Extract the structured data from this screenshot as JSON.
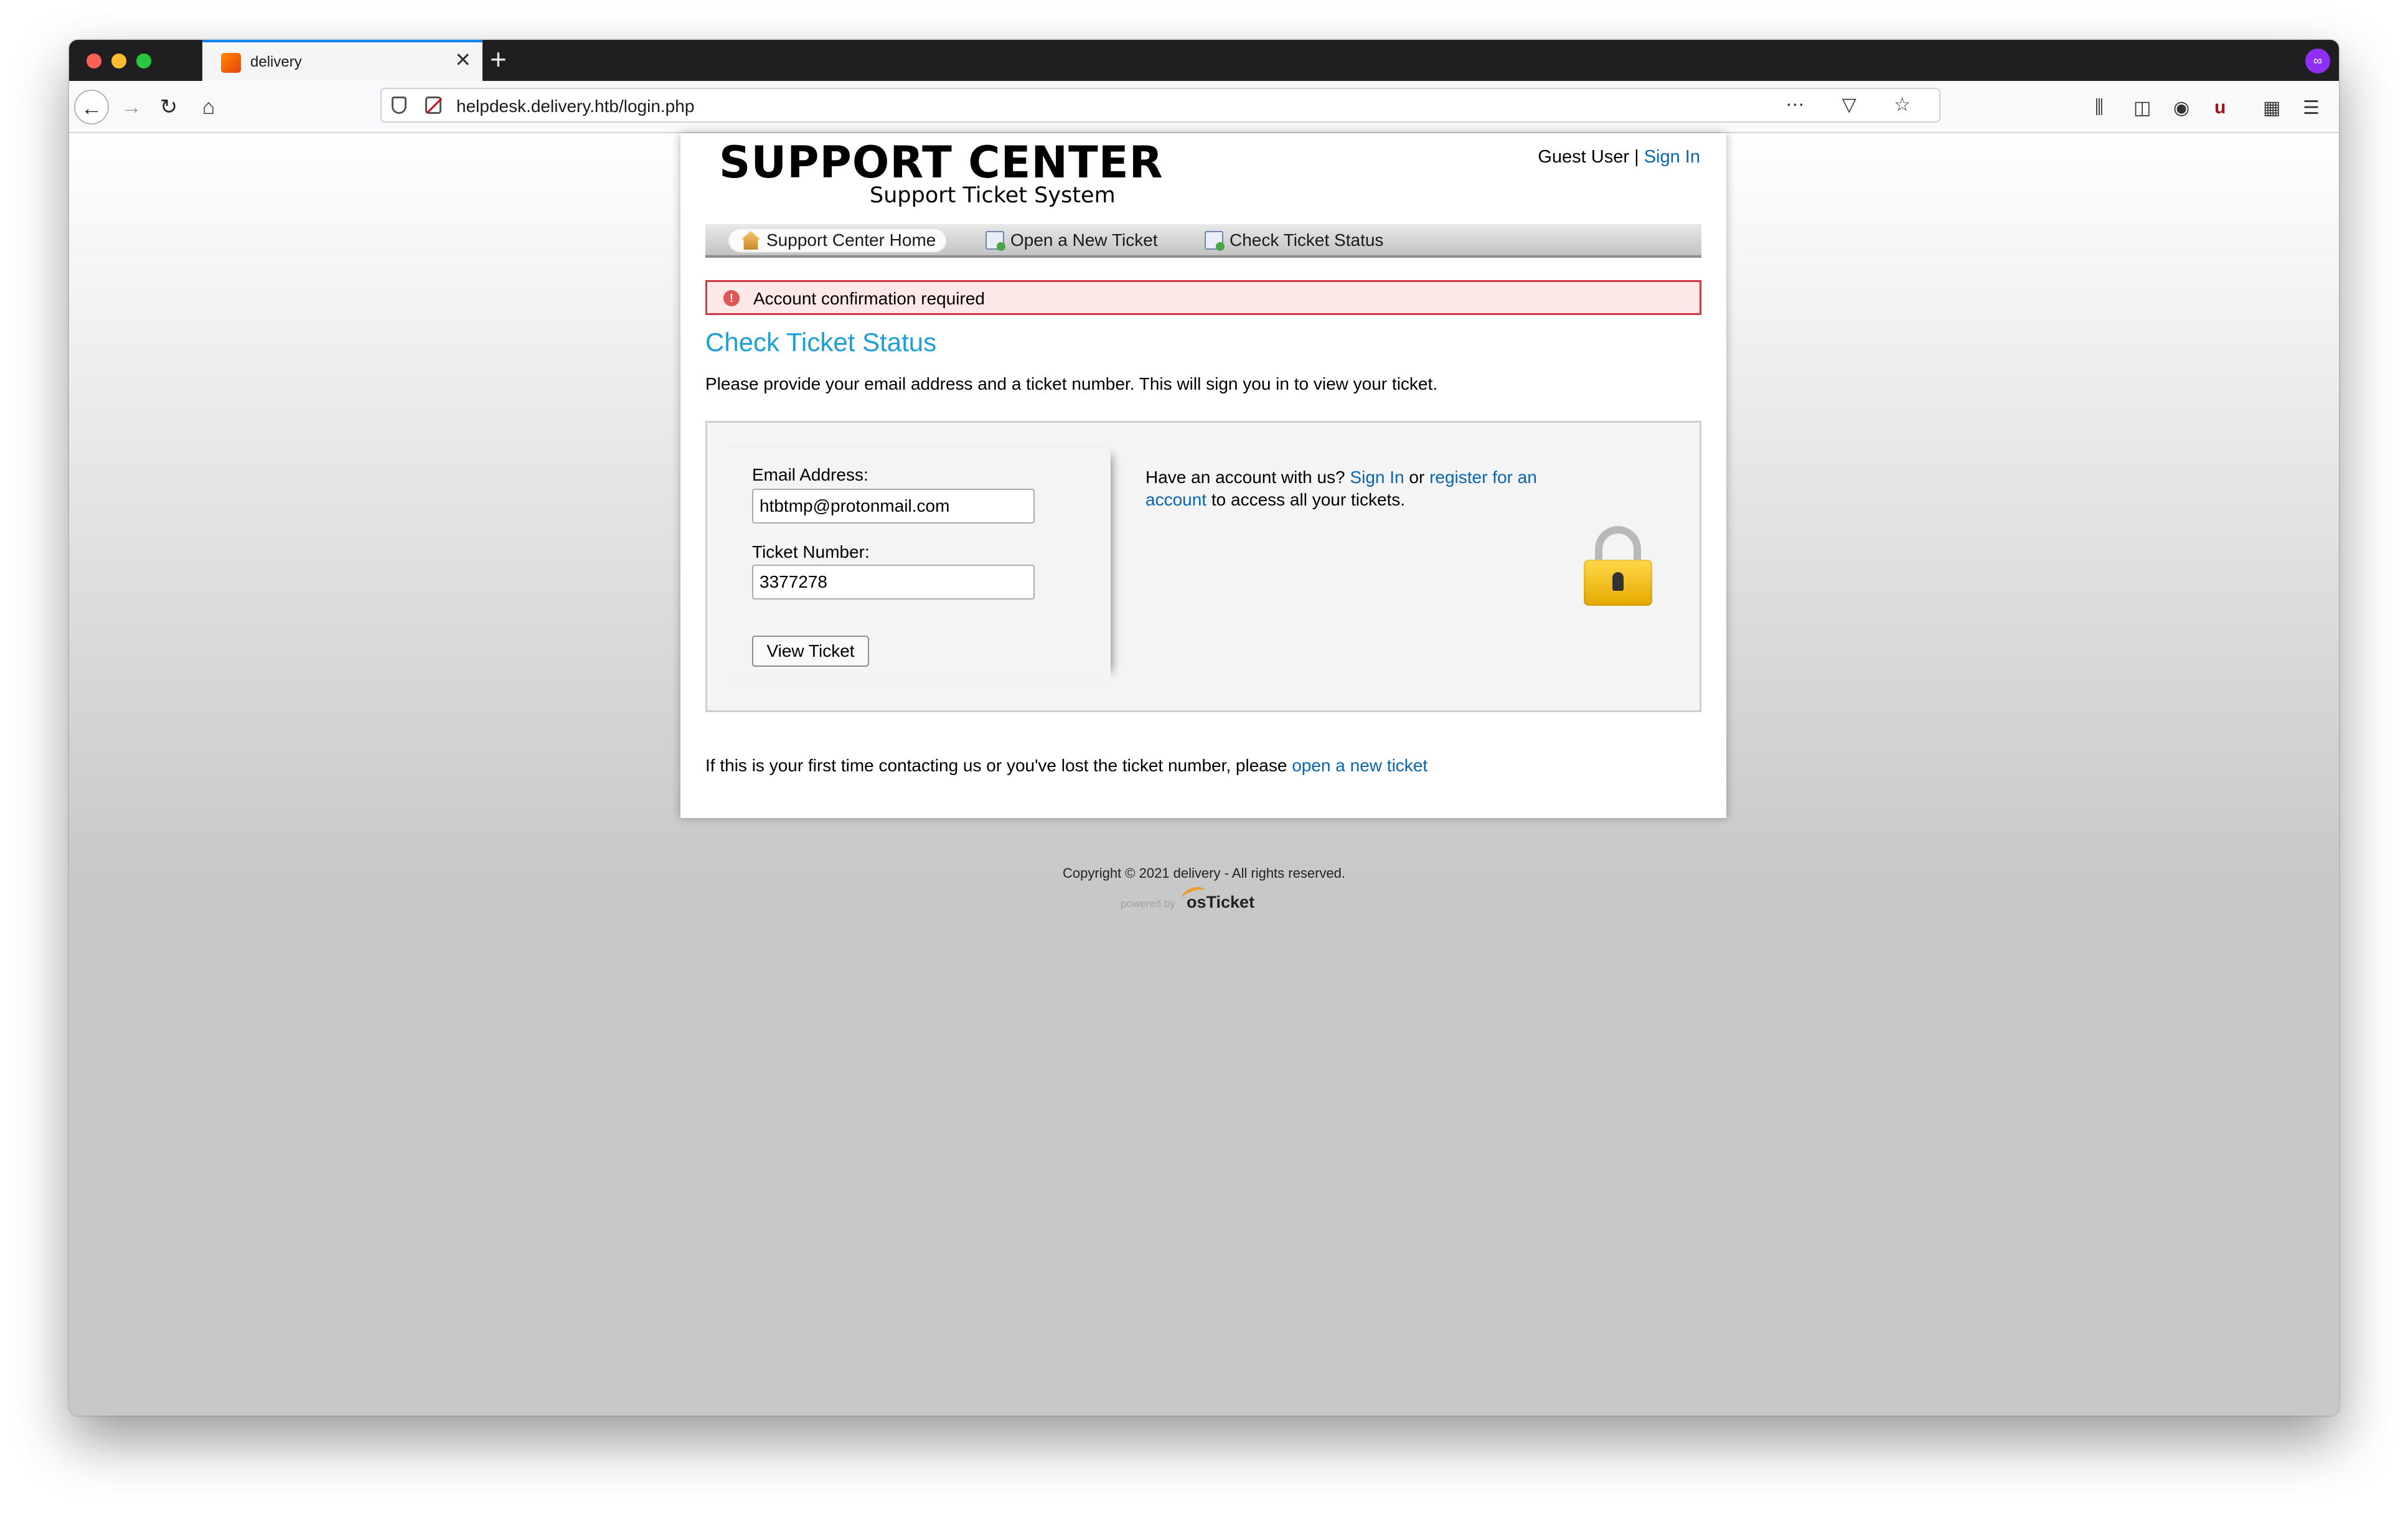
{
  "browser": {
    "tab_title": "delivery",
    "tab_close": "✕",
    "new_tab": "+",
    "url": "helpdesk.delivery.htb/login.php",
    "url_actions": "⋯ ▽ ☆",
    "icons": {
      "back": "←",
      "forward": "→",
      "reload": "↻",
      "home": "⌂",
      "library": "⫼",
      "sidebar": "◫",
      "account": "◉",
      "ublock": "u",
      "extensions": "▦",
      "menu": "☰",
      "private": "∞"
    }
  },
  "header": {
    "title": "SUPPORT CENTER",
    "subtitle": "Support Ticket System",
    "guest_label": "Guest User",
    "separator": "|",
    "signin_link": "Sign In"
  },
  "nav": {
    "items": [
      {
        "label": "Support Center Home"
      },
      {
        "label": "Open a New Ticket"
      },
      {
        "label": "Check Ticket Status"
      }
    ]
  },
  "alert": {
    "icon": "!",
    "message": "Account confirmation required"
  },
  "main": {
    "heading": "Check Ticket Status",
    "intro": "Please provide your email address and a ticket number. This will sign you in to view your ticket.",
    "form": {
      "email_label": "Email Address:",
      "email_value": "htbtmp@protonmail.com",
      "ticket_label": "Ticket Number:",
      "ticket_value": "3377278",
      "submit_label": "View Ticket"
    },
    "side": {
      "prefix": "Have an account with us?",
      "signin_link": "Sign In",
      "or": "or",
      "register_link": "register for an account",
      "suffix": "to access all your tickets."
    },
    "first_time_prefix": "If this is your first time contacting us or you've lost the ticket number, please",
    "first_time_link": "open a new ticket"
  },
  "footer": {
    "copyright": "Copyright © 2021 delivery - All rights reserved.",
    "powered_by": "powered by",
    "powered_logo": "osTicket"
  },
  "colors": {
    "heading": "#1c9fd6",
    "link": "#0a64b0",
    "alert_border": "#d2373f",
    "alert_bg": "#fde8e8"
  }
}
